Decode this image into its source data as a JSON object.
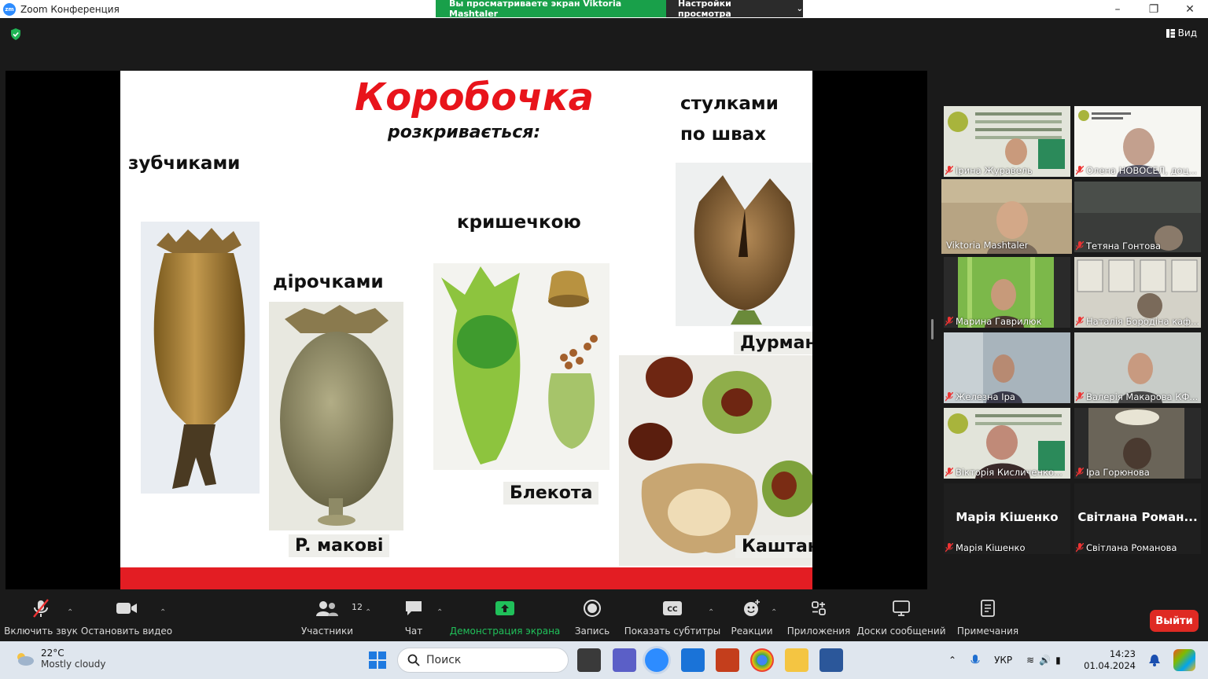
{
  "window": {
    "app_title": "Zoom Конференция",
    "app_logo_text": "zm",
    "share_banner": "Вы просматриваете экран Viktoria Mashtaler",
    "view_settings": "Настройки просмотра",
    "view_button": "Вид"
  },
  "slide": {
    "title": "Коробочка",
    "subtitle": "розкривається:",
    "labels": {
      "teeth": "зубчиками",
      "holes": "дірочками",
      "lid": "кришечкою",
      "valves_line1": "стулками",
      "valves_line2": "по швах"
    },
    "captions": {
      "poppy": "P. макові",
      "henbane": "Блекота",
      "datura": "Дурман",
      "chestnut": "Каштан"
    }
  },
  "participants": [
    {
      "name": "Ірина Журавель",
      "muted": true,
      "active": false,
      "video": true
    },
    {
      "name": "Олена НОВОСЕЛ, доц...",
      "muted": true,
      "active": false,
      "video": true
    },
    {
      "name": "Viktoria Mashtaler",
      "muted": false,
      "active": true,
      "video": true
    },
    {
      "name": "Тетяна Гонтова",
      "muted": true,
      "active": false,
      "video": true
    },
    {
      "name": "Марина Гаврилюк",
      "muted": true,
      "active": false,
      "video": true
    },
    {
      "name": "Наталія Бородіна каф...",
      "muted": true,
      "active": false,
      "video": true
    },
    {
      "name": "Железна Іра",
      "muted": true,
      "active": false,
      "video": true
    },
    {
      "name": "Валерія Макарова КФ...",
      "muted": true,
      "active": false,
      "video": true
    },
    {
      "name": "Вікторія Кисличенко...",
      "muted": true,
      "active": false,
      "video": true
    },
    {
      "name": "Іра Горюнова",
      "muted": true,
      "active": false,
      "video": true
    },
    {
      "name": "Марія Кішенко",
      "display": "Марія Кішенко",
      "muted": true,
      "active": false,
      "video": false
    },
    {
      "name": "Світлана Романова",
      "display": "Світлана Роман...",
      "muted": true,
      "active": false,
      "video": false
    }
  ],
  "toolbar": {
    "unmute": "Включить звук",
    "stop_video": "Остановить видео",
    "participants": "Участники",
    "participants_count": "12",
    "chat": "Чат",
    "share_screen": "Демонстрация экрана",
    "record": "Запись",
    "captions": "Показать субтитры",
    "reactions": "Реакции",
    "apps": "Приложения",
    "whiteboards": "Доски сообщений",
    "notes": "Примечания",
    "leave": "Выйти"
  },
  "taskbar": {
    "temperature": "22°C",
    "weather": "Mostly cloudy",
    "search_placeholder": "Поиск",
    "language": "УКР",
    "time": "14:23",
    "date": "01.04.2024"
  },
  "colors": {
    "accent_green": "#19a04a",
    "slide_red": "#e31d23",
    "leave_red": "#df2a23",
    "active_speaker": "#e3e36a"
  }
}
